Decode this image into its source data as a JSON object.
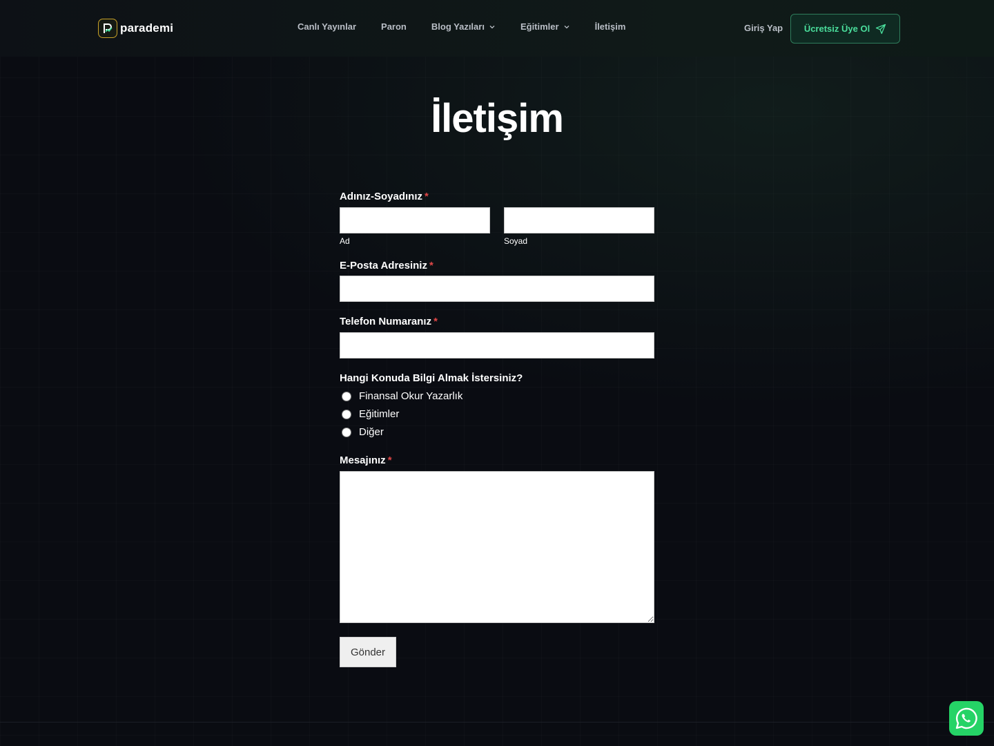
{
  "brand": {
    "name": "parademi",
    "accent": "#c9a227"
  },
  "nav": {
    "items": [
      {
        "label": "Canlı Yayınlar",
        "dropdown": false
      },
      {
        "label": "Paron",
        "dropdown": false
      },
      {
        "label": "Blog Yazıları",
        "dropdown": true
      },
      {
        "label": "Eğitimler",
        "dropdown": true
      },
      {
        "label": "İletişim",
        "dropdown": false
      }
    ],
    "login_label": "Giriş Yap",
    "signup_label": "Ücretsiz Üye Ol",
    "signup_color": "#4ade9c"
  },
  "page": {
    "title": "İletişim"
  },
  "form": {
    "name": {
      "label": "Adınız-Soyadınız",
      "required_mark": "*",
      "first_sub": "Ad",
      "last_sub": "Soyad"
    },
    "email": {
      "label": "E-Posta Adresiniz",
      "required_mark": "*"
    },
    "phone": {
      "label": "Telefon Numaranız",
      "required_mark": "*"
    },
    "topic": {
      "label": "Hangi Konuda Bilgi Almak İstersiniz?",
      "options": [
        "Finansal Okur Yazarlık",
        "Eğitimler",
        "Diğer"
      ]
    },
    "message": {
      "label": "Mesajınız",
      "required_mark": "*"
    },
    "submit_label": "Gönder"
  },
  "icons": {
    "chevron": "chevron-down-icon",
    "send": "send-icon",
    "chat": "whatsapp-icon"
  },
  "colors": {
    "background": "#0a0c12",
    "required": "#e04747",
    "whatsapp": "#25d366"
  }
}
